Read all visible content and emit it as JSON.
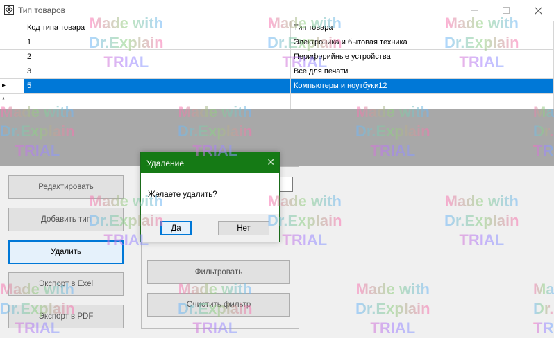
{
  "window": {
    "title": "Тип товаров",
    "minimize_icon": "minimize-icon",
    "maximize_icon": "maximize-icon",
    "close_icon": "close-icon"
  },
  "grid": {
    "columns": [
      "Код типа товара",
      "Тип товара"
    ],
    "rows": [
      {
        "code": "1",
        "type": "Электроника и бытовая техника"
      },
      {
        "code": "2",
        "type": "Периферийные устройства"
      },
      {
        "code": "3",
        "type": "Все для печати"
      },
      {
        "code": "5",
        "type": "Компьютеры и ноутбуки12"
      }
    ],
    "selected_row_index": 3,
    "current_row_marker": "▸",
    "new_row_marker": "*"
  },
  "buttons": {
    "edit": "Редактировать",
    "add": "Добавить тип",
    "delete": "Удалить",
    "export_excel": "Экспорт в Exel",
    "export_pdf": "Экспорт в PDF",
    "filter": "Фильтровать",
    "clear_filter": "Очистить фильтр"
  },
  "dialog": {
    "title": "Удаление",
    "message": "Желаете удалить?",
    "yes": "Да",
    "no": "Нет",
    "close_icon": "close-icon"
  },
  "watermark": {
    "line1": "Made with",
    "line2": "Dr.Explain",
    "line3": "TRIAL"
  },
  "colors": {
    "selection": "#0078d7",
    "dialog_title": "#157a15"
  }
}
